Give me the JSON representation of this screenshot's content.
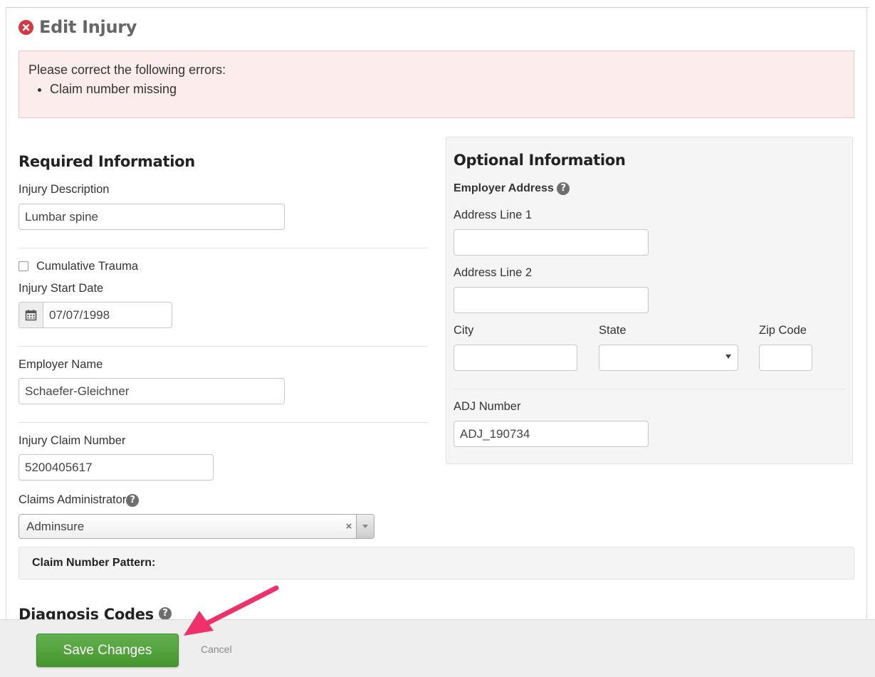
{
  "header": {
    "title": "Edit Injury"
  },
  "errors": {
    "heading": "Please correct the following errors:",
    "items": [
      "Claim number missing"
    ]
  },
  "required": {
    "title": "Required Information",
    "injury_description": {
      "label": "Injury Description",
      "value": "Lumbar spine"
    },
    "cumulative_trauma": {
      "label": "Cumulative Trauma",
      "checked": false
    },
    "injury_start_date": {
      "label": "Injury Start Date",
      "value": "07/07/1998"
    },
    "employer_name": {
      "label": "Employer Name",
      "value": "Schaefer-Gleichner"
    },
    "claim_number": {
      "label": "Injury Claim Number",
      "value": "5200405617"
    },
    "claims_administrator": {
      "label": "Claims Administrator",
      "value": "Adminsure"
    },
    "claim_number_pattern": {
      "label": "Claim Number Pattern:"
    }
  },
  "optional": {
    "title": "Optional Information",
    "employer_address_label": "Employer Address",
    "address_line_1": {
      "label": "Address Line 1",
      "value": ""
    },
    "address_line_2": {
      "label": "Address Line 2",
      "value": ""
    },
    "city": {
      "label": "City",
      "value": ""
    },
    "state": {
      "label": "State",
      "value": ""
    },
    "zip": {
      "label": "Zip Code",
      "value": ""
    },
    "adj_number": {
      "label": "ADJ Number",
      "value": "ADJ_190734"
    }
  },
  "diagnosis": {
    "title": "Diagnosis Codes"
  },
  "footer": {
    "save_label": "Save Changes",
    "cancel_label": "Cancel"
  },
  "help_glyph": "?",
  "icons": {
    "title": "close-circle-icon",
    "date": "calendar-icon",
    "help": "question-circle-icon",
    "clear": "clear-icon",
    "dropdown": "chevron-down-icon",
    "annotation": "arrow-annotation"
  },
  "colors": {
    "error_bg": "#fcecec",
    "error_icon": "#d9363e",
    "save_button": "#4fa13a",
    "annotation_arrow": "#f0306a"
  }
}
